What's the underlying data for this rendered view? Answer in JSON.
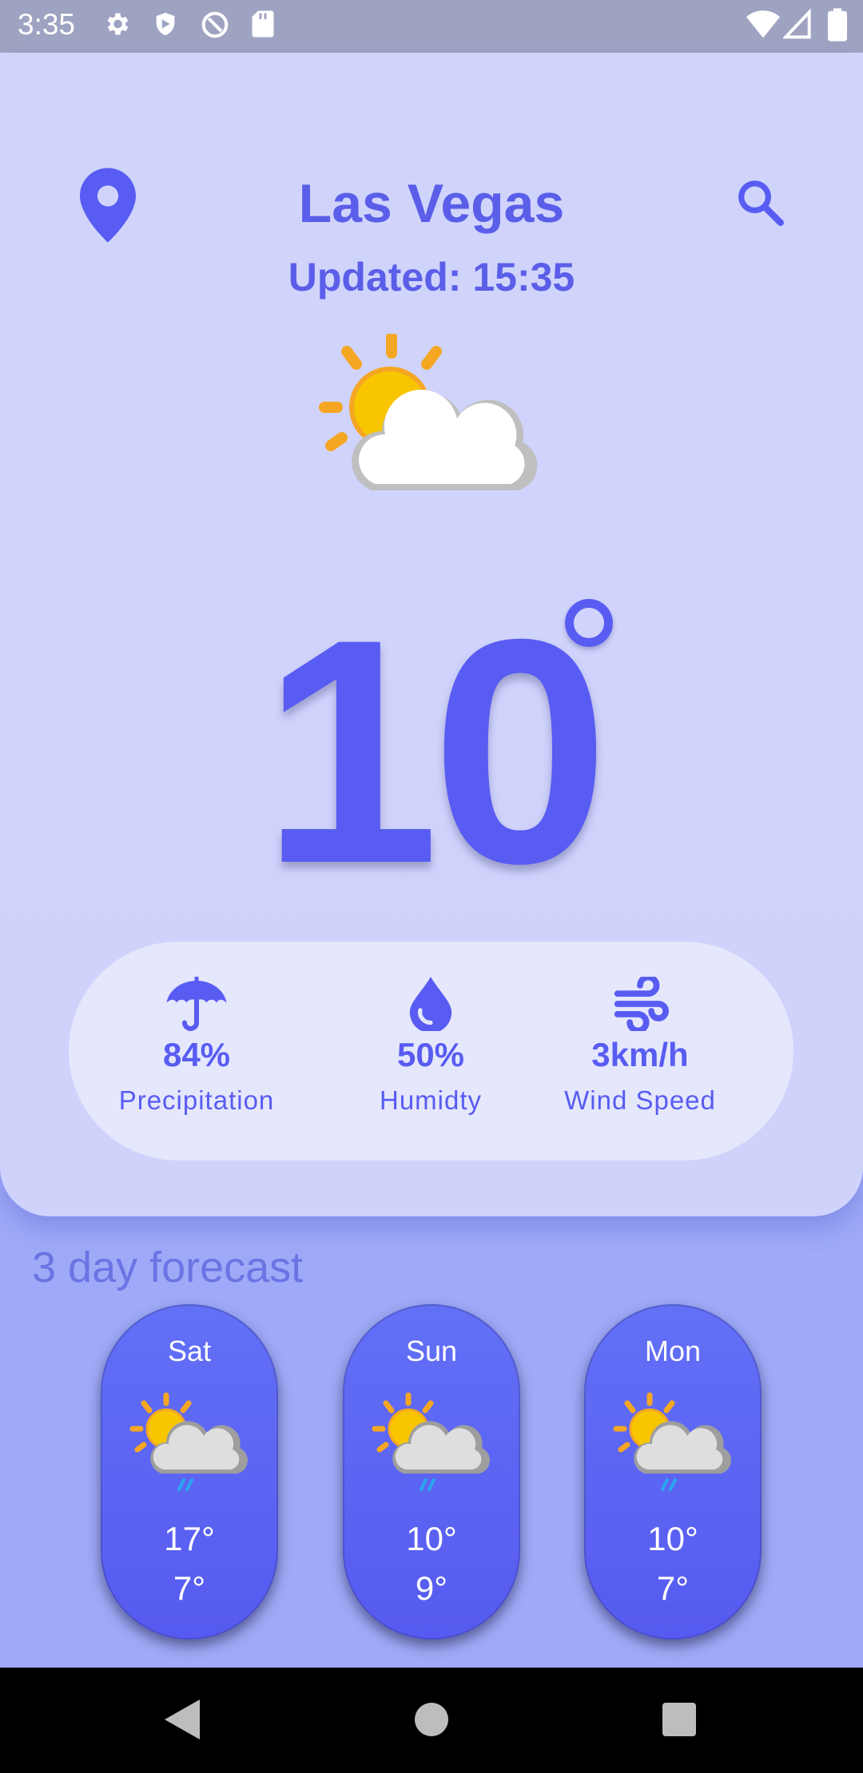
{
  "status_bar": {
    "time": "3:35",
    "left_icons": [
      "gear-icon",
      "shield-icon",
      "at-sign-icon",
      "sd-card-icon"
    ],
    "right_icons": [
      "wifi-icon",
      "signal-icon",
      "battery-icon"
    ]
  },
  "header": {
    "city": "Las Vegas",
    "updated": "Updated: 15:35",
    "location_icon": "location-pin-icon",
    "search_icon": "search-icon"
  },
  "current": {
    "icon": "partly-cloudy-icon",
    "temperature": "10",
    "degree_symbol": "°"
  },
  "stats": [
    {
      "icon": "umbrella-icon",
      "value": "84%",
      "label": "Precipitation"
    },
    {
      "icon": "water-drop-icon",
      "value": "50%",
      "label": "Humidty"
    },
    {
      "icon": "wind-icon",
      "value": "3km/h",
      "label": "Wind Speed"
    }
  ],
  "forecast": {
    "title": "3 day forecast",
    "days": [
      {
        "day": "Sat",
        "icon": "partly-cloudy-rain-icon",
        "high": "17°",
        "low": "7°"
      },
      {
        "day": "Sun",
        "icon": "partly-cloudy-rain-icon",
        "high": "10°",
        "low": "9°"
      },
      {
        "day": "Mon",
        "icon": "partly-cloudy-rain-icon",
        "high": "10°",
        "low": "7°"
      }
    ]
  },
  "colors": {
    "accent": "#585cf2",
    "card_bg": "#d0d4fb",
    "page_bg": "#9eaaf7",
    "forecast_card": "#5a62f2"
  },
  "nav_bar": [
    "back-icon",
    "home-icon",
    "recents-icon"
  ]
}
